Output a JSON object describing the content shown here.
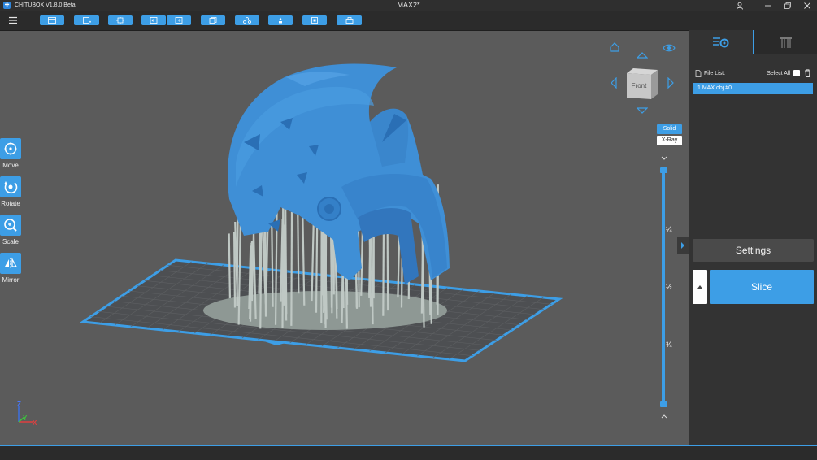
{
  "app": {
    "title": "CHITUBOX V1.8.0 Beta",
    "logo_glyph": "✚",
    "document_title": "MAX2*"
  },
  "window_controls": [
    "user-icon",
    "minimize-icon",
    "restore-icon",
    "close-icon"
  ],
  "toolbar": {
    "icons": [
      "menu-icon",
      "open-file-icon",
      "save-file-icon",
      "auto-layout-icon",
      "undo-icon",
      "redo-icon",
      "duplicate-icon",
      "hollow-icon",
      "support-icon",
      "center-icon",
      "machine-settings-icon"
    ]
  },
  "left_tools": [
    {
      "label": "Move",
      "icon": "move-icon"
    },
    {
      "label": "Rotate",
      "icon": "rotate-icon"
    },
    {
      "label": "Scale",
      "icon": "scale-icon"
    },
    {
      "label": "Mirror",
      "icon": "mirror-icon"
    }
  ],
  "view_cube": {
    "face_label": "Front"
  },
  "render_modes": {
    "solid": "Solid",
    "xray": "X-Ray",
    "active": "Solid"
  },
  "layer_slider": {
    "fractions": [
      "¼",
      "½",
      "¾"
    ],
    "upper": 1.0,
    "lower": 0.0
  },
  "axes": {
    "x": "X",
    "y": "Y",
    "z": "Z"
  },
  "panel": {
    "tabs": [
      "settings-tab-icon",
      "supports-tab-icon"
    ],
    "file_list_label": "File List:",
    "select_all_label": "Select All",
    "files": [
      "1.MAX.obj #0"
    ]
  },
  "buttons": {
    "settings": "Settings",
    "slice": "Slice"
  },
  "colors": {
    "accent": "#3d9ee6",
    "model": "#3f8fd6",
    "supports": "#b7c1bd",
    "background": "#5b5b5b"
  }
}
